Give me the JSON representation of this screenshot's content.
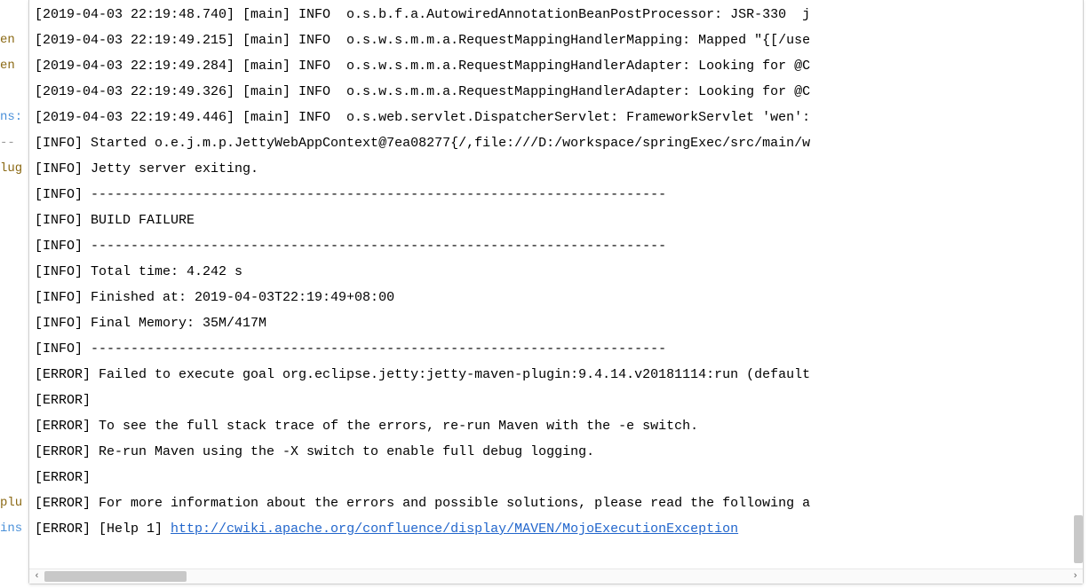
{
  "gutter": [
    {
      "text": "",
      "cls": ""
    },
    {
      "text": "en",
      "cls": "gutter-brown"
    },
    {
      "text": "en",
      "cls": "gutter-brown"
    },
    {
      "text": "",
      "cls": ""
    },
    {
      "text": "ns:",
      "cls": "gutter-blue"
    },
    {
      "text": "--",
      "cls": "gutter-gray"
    },
    {
      "text": "lug",
      "cls": "gutter-brown"
    },
    {
      "text": " ",
      "cls": ""
    },
    {
      "text": "",
      "cls": ""
    },
    {
      "text": "",
      "cls": ""
    },
    {
      "text": "",
      "cls": ""
    },
    {
      "text": "",
      "cls": ""
    },
    {
      "text": "",
      "cls": ""
    },
    {
      "text": "",
      "cls": ""
    },
    {
      "text": "",
      "cls": ""
    },
    {
      "text": "",
      "cls": ""
    },
    {
      "text": "",
      "cls": ""
    },
    {
      "text": "",
      "cls": ""
    },
    {
      "text": "",
      "cls": ""
    },
    {
      "text": "plu",
      "cls": "gutter-brown"
    },
    {
      "text": "ins",
      "cls": "gutter-blue"
    }
  ],
  "log_lines": [
    {
      "text": "[2019-04-03 22:19:48.740] [main] INFO  o.s.b.f.a.AutowiredAnnotationBeanPostProcessor: JSR-330  j"
    },
    {
      "text": "[2019-04-03 22:19:49.215] [main] INFO  o.s.w.s.m.m.a.RequestMappingHandlerMapping: Mapped \"{[/use"
    },
    {
      "text": "[2019-04-03 22:19:49.284] [main] INFO  o.s.w.s.m.m.a.RequestMappingHandlerAdapter: Looking for @C"
    },
    {
      "text": "[2019-04-03 22:19:49.326] [main] INFO  o.s.w.s.m.m.a.RequestMappingHandlerAdapter: Looking for @C"
    },
    {
      "text": "[2019-04-03 22:19:49.446] [main] INFO  o.s.web.servlet.DispatcherServlet: FrameworkServlet 'wen':"
    },
    {
      "text": "[INFO] Started o.e.j.m.p.JettyWebAppContext@7ea08277{/,file:///D:/workspace/springExec/src/main/w"
    },
    {
      "text": "[INFO] Jetty server exiting."
    },
    {
      "text": "[INFO] ------------------------------------------------------------------------"
    },
    {
      "text": "[INFO] BUILD FAILURE"
    },
    {
      "text": "[INFO] ------------------------------------------------------------------------"
    },
    {
      "text": "[INFO] Total time: 4.242 s"
    },
    {
      "text": "[INFO] Finished at: 2019-04-03T22:19:49+08:00"
    },
    {
      "text": "[INFO] Final Memory: 35M/417M"
    },
    {
      "text": "[INFO] ------------------------------------------------------------------------"
    },
    {
      "text": "[ERROR] Failed to execute goal org.eclipse.jetty:jetty-maven-plugin:9.4.14.v20181114:run (default"
    },
    {
      "text": "[ERROR]"
    },
    {
      "text": "[ERROR] To see the full stack trace of the errors, re-run Maven with the -e switch."
    },
    {
      "text": "[ERROR] Re-run Maven using the -X switch to enable full debug logging."
    },
    {
      "text": "[ERROR]"
    },
    {
      "text": "[ERROR] For more information about the errors and possible solutions, please read the following a"
    },
    {
      "text": "[ERROR] [Help 1] ",
      "link": "http://cwiki.apache.org/confluence/display/MAVEN/MojoExecutionException"
    }
  ],
  "scroll": {
    "left_arrow": "‹",
    "right_arrow": "›"
  }
}
